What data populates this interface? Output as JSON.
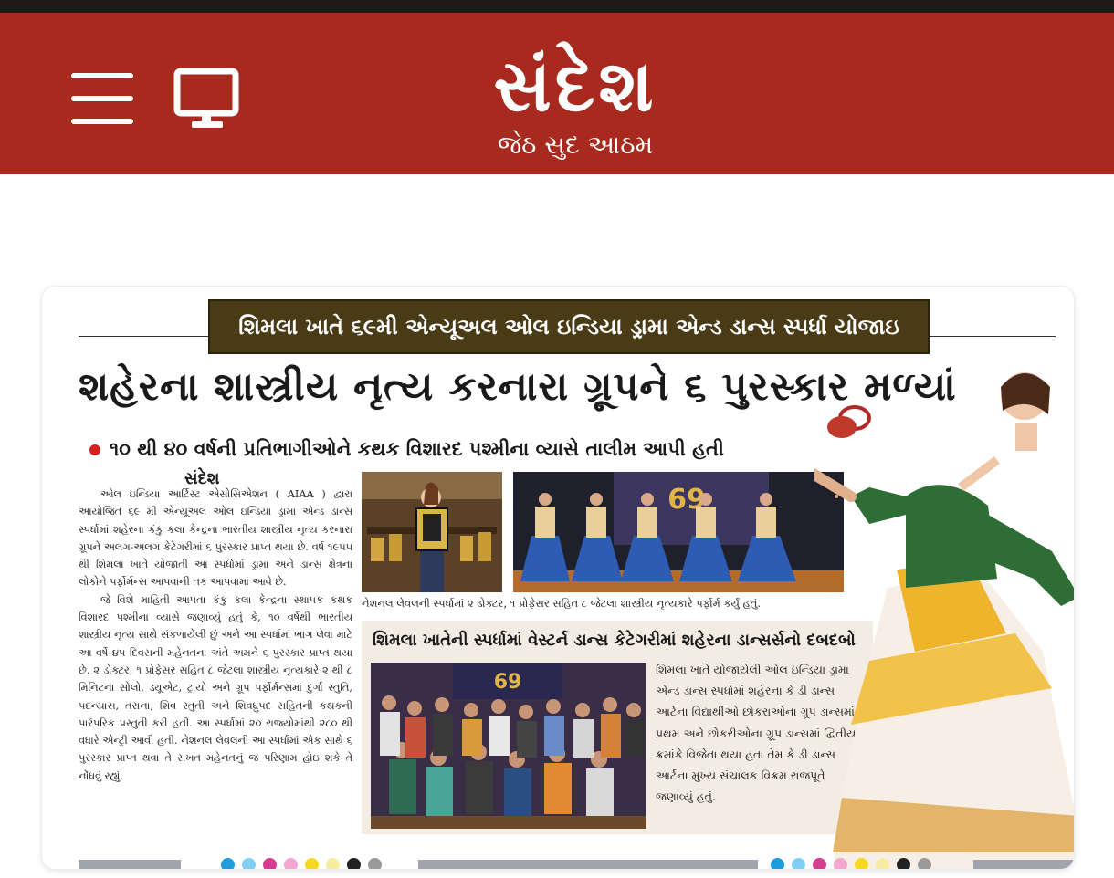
{
  "app": {
    "logo_text": "સંદેશ",
    "date_text": "જેઠ સુદ આઠમ",
    "colors": {
      "header": "#a82a1f",
      "kicker_bg": "#4a3b17",
      "bullet": "#d6201f"
    }
  },
  "toolbar": {
    "menu_icon": "hamburger-menu-icon",
    "tv_icon": "monitor-icon"
  },
  "article": {
    "kicker": "શિમલા ખાતે ૬૯મી એન્યૂઅલ ઓલ ઇન્ડિયા ડ્રામા એન્ડ ડાન્સ સ્પર્ધા યોજાઇ",
    "headline": "શહેરના શાસ્ત્રીય નૃત્ય કરનારા ગ્રૂપને ૬ પુરસ્કાર મળ્યાં",
    "subhead": "૧૦ થી ૪૦ વર્ષની પ્રતિભાગીઓને કથક વિશારદ પશ્મીના વ્યાસે તાલીમ આપી હતી",
    "byline": "સંદેશ",
    "paragraph1": "ઓલ ઇન્ડિયા આર્ટિસ્ટ એસોસિએશન ( AIAA ) દ્વારા આયોજિત ૬૯ મી એન્યૂઅલ ઓલ ઇન્ડિયા ડ્રામા એન્ડ ડાન્સ સ્પર્ધામાં શહેરના કંકુ કલા કેન્દ્રના ભારતીય શાસ્ત્રીય નૃત્ય કરનારા ગ્રૂપને અલગ-અલગ કેટેગરીમાં ૬ પુરસ્કાર પ્રાપ્ત થયા છે. વર્ષ ૧૯૫૫ થી શિમલા ખાતે યોજાતી આ સ્પર્ધામાં ડ્રામા અને ડાન્સ ક્ષેત્રના લોકોને પર્ફોર્મન્સ આપવાની તક આપવામાં આવે છે.",
    "paragraph2": "જે વિશે માહિતી આપતા કંકુ કલા કેન્દ્રના સ્થાપક કથક વિશારદ પશ્મીના વ્યાસે જણાવ્યું હતું કે, ૧૦ વર્ષથી ભારતીય શાસ્ત્રીય નૃત્ય સાથે સંકળાયેલી છું અને આ સ્પર્ધામાં ભાગ લેવા માટે આ વર્ષે ૪૫ દિવસની મહેનતના અંતે અમને ૬ પુરસ્કાર પ્રાપ્ત થયા છે. ૨ ડોક્ટર, ૧ પ્રોફેસર સહિત ૮ જેટલા શાસ્ત્રીય નૃત્યકારે ૨ થી ૮ મિનિટના સોલો, ડ્યૂએટ, ટ્રાયો અને ગ્રૂપ પર્ફોર્મન્સમાં દુર્ગા સ્તુતિ, પદન્યાસ, તરાના, શિવ સ્તુતી અને શિવધ્રુપદ સહિતની કથકની પારંપરિક પ્રસ્તુતી કરી હતી. આ સ્પર્ધામાં ૨૦ રાજ્યોમાંથી ૨૮૦ થી વધારે એન્ટ્રી આવી હતી. નેશનલ લેવલની આ સ્પર્ધામાં એક સાથે ૬ પુરસ્કાર પ્રાપ્ત થવા તે સખત મહેનતનું જ પરિણામ હોઇ શકે તે નોંધવું રહ્યું.",
    "photo_caption": "નેશનલ લેવલની સ્પર્ધામાં ૨ ડોક્ટર, ૧ પ્રોફેસર સહિત ૮ જેટલા શાસ્ત્રીય નૃત્યકારે પર્ફોર્મ કર્યું હતું.",
    "photo_banner_number": "69",
    "sidebar": {
      "title": "શિમલા ખાતેની સ્પર્ધામાં વેસ્ટર્ન ડાન્સ કેટેગરીમાં શહેરના ડાન્સર્સનો દબદબો",
      "text": "શિમલા ખાતે યોજાયેલી ઓલ ઇન્ડિયા ડ્રામા એન્ડ ડાન્સ સ્પર્ધામાં શહેરના કે ડી ડાન્સ આર્ટના વિદ્યાર્થીઓ છોકરાઓના ગ્રૂપ ડાન્સમાં પ્રથમ અને છોકરીઓના ગ્રૂપ ડાન્સમાં દ્વિતીય ક્રમાંકે વિજેતા થયા હતા તેમ કે ડી ડાન્સ આર્ટના મુખ્ય સંચાલક વિક્રમ રાજપૂતે જણાવ્યું હતું."
    }
  },
  "print_marks": {
    "dot_colors": [
      "#1f9de0",
      "#7fd0f2",
      "#d63c8f",
      "#f3a6cf",
      "#f5d91f",
      "#f8ec9e",
      "#222222",
      "#9a9a9a"
    ]
  }
}
